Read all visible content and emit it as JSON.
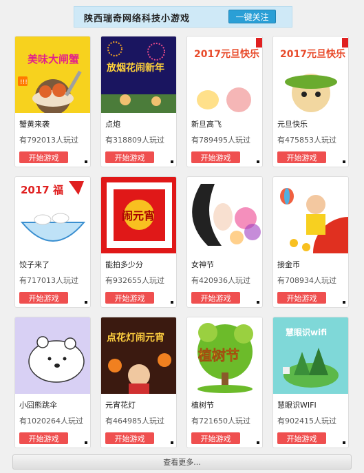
{
  "header": {
    "title": "陕西瑞奇网络科技小游戏",
    "follow_label": "一键关注"
  },
  "games": [
    {
      "name": "蟹黄来袭",
      "plays": "有792013人玩过",
      "button": "开始游戏",
      "thumb_text": "美味大闸蟹"
    },
    {
      "name": "点炮",
      "plays": "有318809人玩过",
      "button": "开始游戏",
      "thumb_text": "放烟花闹新年"
    },
    {
      "name": "新旦高飞",
      "plays": "有789495人玩过",
      "button": "开始游戏",
      "thumb_text": "2017元旦快乐"
    },
    {
      "name": "元旦快乐",
      "plays": "有475853人玩过",
      "button": "开始游戏",
      "thumb_text": "2017元旦快乐"
    },
    {
      "name": "饺子来了",
      "plays": "有717013人玩过",
      "button": "开始游戏",
      "thumb_text": "2017 福"
    },
    {
      "name": "能拍多少分",
      "plays": "有932655人玩过",
      "button": "开始游戏",
      "thumb_text": "闹元宵"
    },
    {
      "name": "女神节",
      "plays": "有420936人玩过",
      "button": "开始游戏",
      "thumb_text": ""
    },
    {
      "name": "接金币",
      "plays": "有708934人玩过",
      "button": "开始游戏",
      "thumb_text": ""
    },
    {
      "name": "小囧熊跳伞",
      "plays": "有1020264人玩过",
      "button": "开始游戏",
      "thumb_text": ""
    },
    {
      "name": "元宵花灯",
      "plays": "有464985人玩过",
      "button": "开始游戏",
      "thumb_text": "点花灯闹元宵"
    },
    {
      "name": "植树节",
      "plays": "有721650人玩过",
      "button": "开始游戏",
      "thumb_text": "植树节"
    },
    {
      "name": "慧眼识WIFI",
      "plays": "有902415人玩过",
      "button": "开始游戏",
      "thumb_text": "慧眼识wifi"
    }
  ],
  "footer": {
    "more_label": "查看更多..."
  },
  "colors": {
    "play_button": "#ef4f4f",
    "follow_button": "#2a9fd6",
    "banner_bg": "#cfe9f7"
  }
}
